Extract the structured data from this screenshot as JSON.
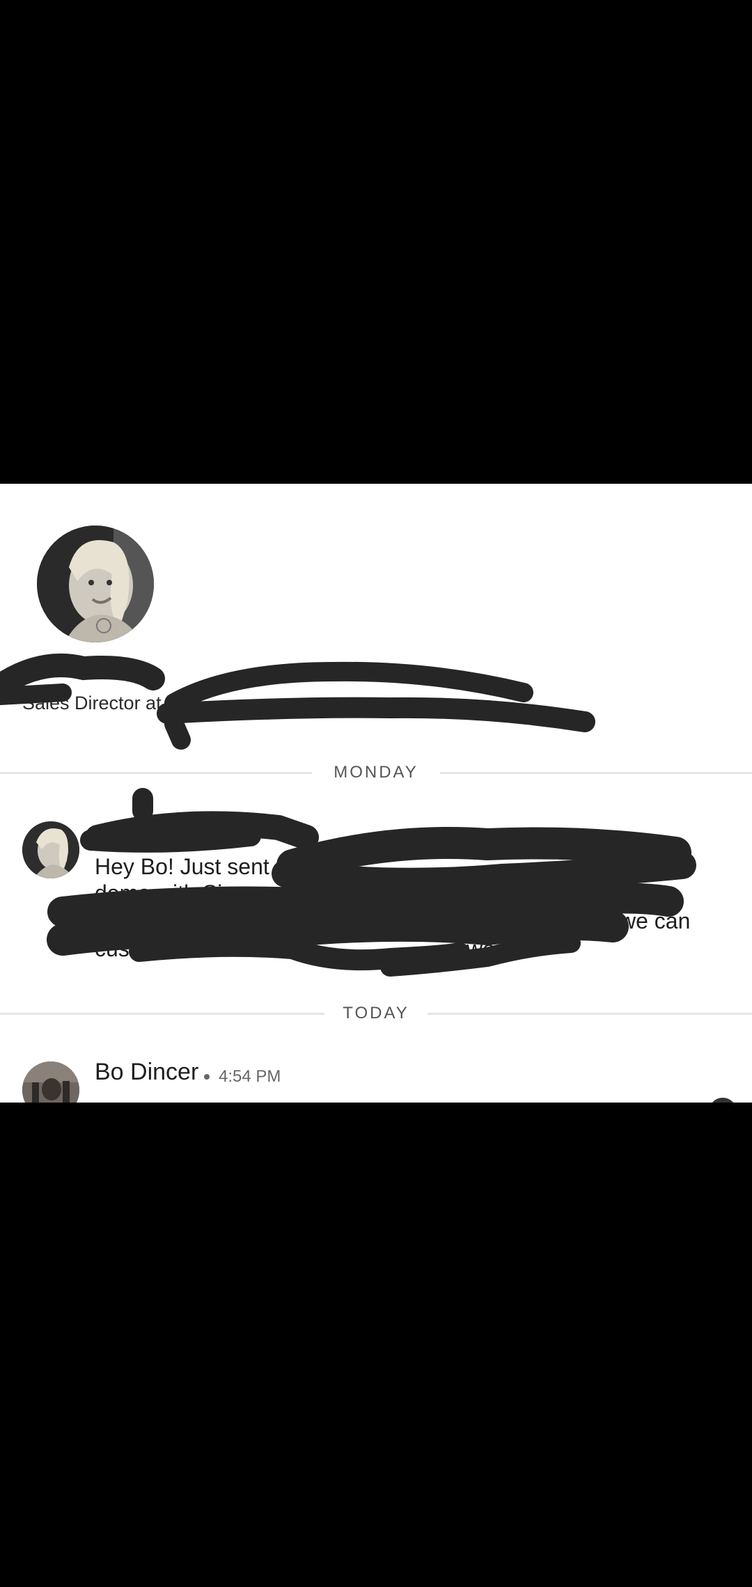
{
  "profile": {
    "headline": "Sales Director at"
  },
  "conversation": {
    "day_separators": [
      "MONDAY",
      "TODAY"
    ],
    "messages": [
      {
        "text_visible": [
          "Hey Bo!  Just sent",
          "demo with Si",
          "we can",
          "cus",
          "week."
        ]
      }
    ],
    "latest": {
      "sender": "Bo Dincer",
      "separator": "•",
      "time": "4:54 PM"
    }
  },
  "icons": {
    "profile_photo": "profile-avatar-photo",
    "message_avatar": "contact-avatar-photo",
    "my_avatar": "user-avatar-photo"
  }
}
